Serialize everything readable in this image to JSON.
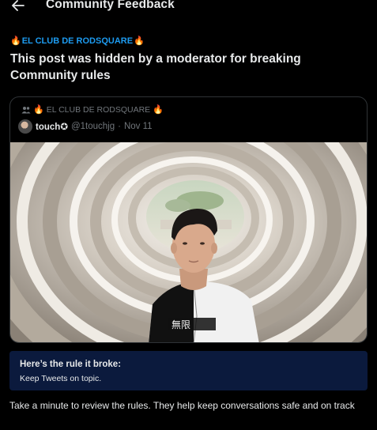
{
  "header": {
    "title": "Community Feedback",
    "back_icon": "arrow-left-icon"
  },
  "notice": {
    "community_name": "EL CLUB DE RODSQUARE",
    "heading": "This post was hidden by a moderator for breaking Community rules"
  },
  "post": {
    "community_name": "EL CLUB DE RODSQUARE",
    "author_name": "touch",
    "author_badge": "✪",
    "handle": "@1touchjg",
    "date": "Nov 11",
    "media_description_icon": "photo-man-in-concrete-tunnel",
    "shirt_text": "無限"
  },
  "rule": {
    "title": "Here’s the rule it broke:",
    "text": "Keep Tweets on topic."
  },
  "footer": {
    "text": "Take a minute to review the rules. They help keep conversations safe and on track"
  },
  "colors": {
    "background": "#000000",
    "accent": "#1d9bf0",
    "rule_box": "#0b1a3d",
    "muted": "#71767b"
  }
}
